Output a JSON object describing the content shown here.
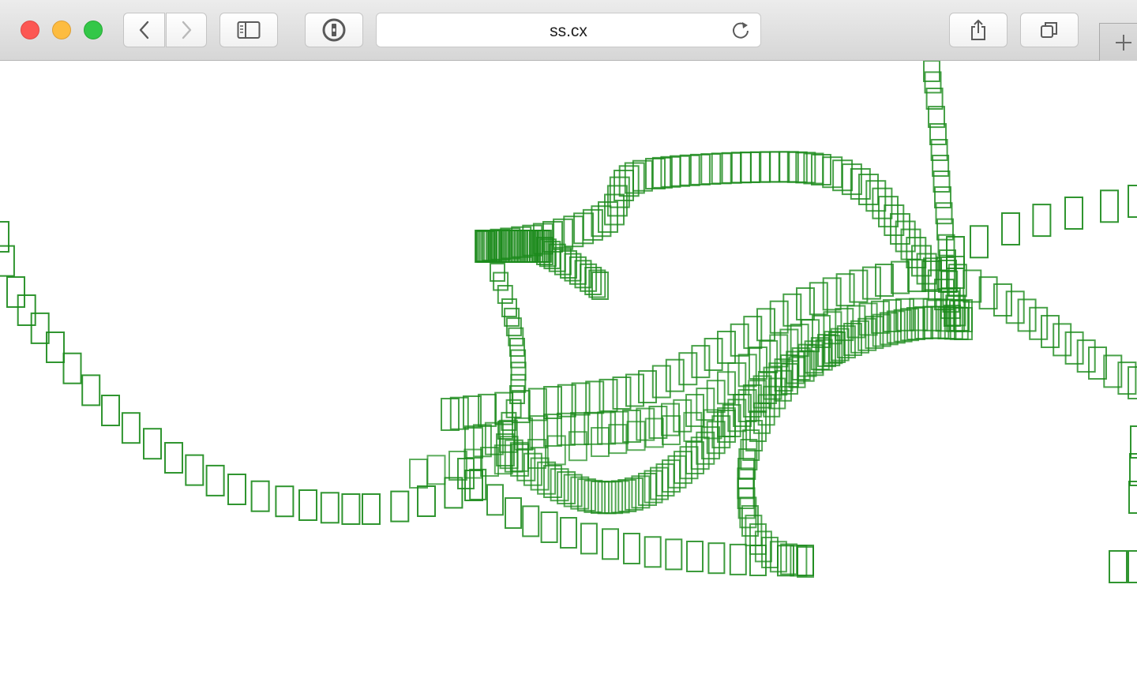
{
  "browser": {
    "address": "ss.cx",
    "icons": {
      "back": "chevron-left-icon",
      "forward": "chevron-right-icon",
      "sidebar": "sidebar-icon",
      "password": "password-manager-icon",
      "reload": "reload-icon",
      "share": "share-icon",
      "tabs": "tab-overview-icon",
      "new_tab": "plus-icon"
    },
    "colors": {
      "close": "#fc5753",
      "minimize": "#fdbc40",
      "maximize": "#33c748"
    }
  },
  "content": {
    "shape_color": "#1a8a1a",
    "shape": "rectangle-outline"
  }
}
